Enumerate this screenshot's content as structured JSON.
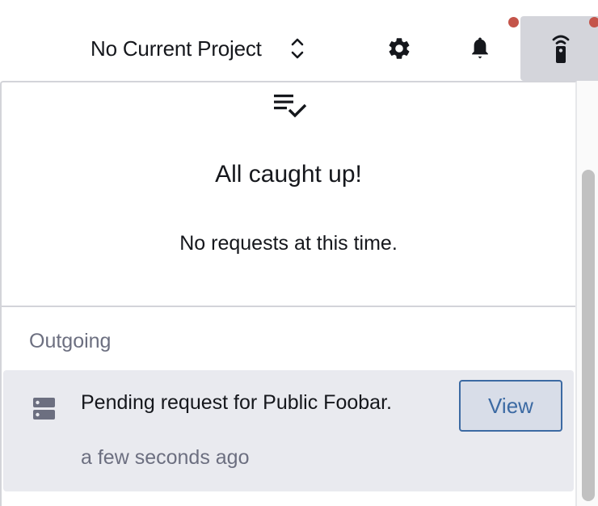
{
  "header": {
    "project_selector": {
      "label": "No Current Project",
      "icon": "chevron-up-down-icon"
    },
    "settings": {
      "icon": "gear-icon"
    },
    "notifications": {
      "icon": "bell-icon",
      "has_badge": true
    },
    "remote_requests": {
      "icon": "remote-control-icon",
      "has_badge": true,
      "active": true
    }
  },
  "panel": {
    "empty_state": {
      "icon": "playlist-check-icon",
      "title": "All caught up!",
      "message": "No requests at this time."
    },
    "sections": [
      {
        "label": "Outgoing",
        "items": [
          {
            "icon": "server-icon",
            "text": "Pending request for Public Foobar.",
            "time": "a few seconds ago",
            "action_label": "View"
          }
        ]
      }
    ]
  },
  "colors": {
    "badge": "#c4544a",
    "accent": "#3c6aa3",
    "muted_text": "#6c6f80",
    "card_bg": "#e9eaef",
    "active_button_bg": "#d4d5db"
  }
}
